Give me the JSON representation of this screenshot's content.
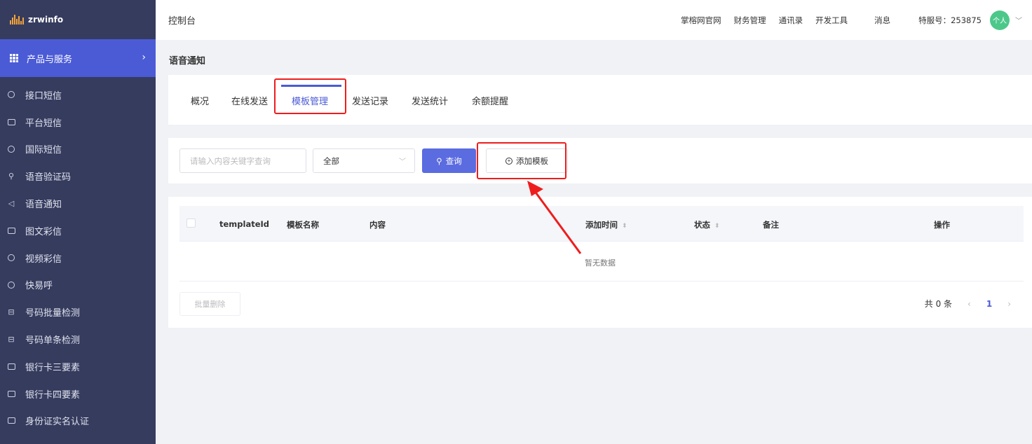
{
  "sidebar": {
    "logo_text": "zrwinfo",
    "header_label": "产品与服务",
    "items": [
      {
        "label": "接口短信",
        "icon": "message-bubble-icon"
      },
      {
        "label": "平台短信",
        "icon": "chat-icon"
      },
      {
        "label": "国际短信",
        "icon": "globe-icon"
      },
      {
        "label": "语音验证码",
        "icon": "microphone-icon"
      },
      {
        "label": "语音通知",
        "icon": "speaker-icon"
      },
      {
        "label": "图文彩信",
        "icon": "image-icon"
      },
      {
        "label": "视频彩信",
        "icon": "play-icon"
      },
      {
        "label": "快易呼",
        "icon": "call-icon"
      },
      {
        "label": "号码批量检测",
        "icon": "scan-icon"
      },
      {
        "label": "号码单条检测",
        "icon": "scan-icon"
      },
      {
        "label": "银行卡三要素",
        "icon": "card-icon"
      },
      {
        "label": "银行卡四要素",
        "icon": "card-icon"
      },
      {
        "label": "身份证实名认证",
        "icon": "id-card-icon"
      }
    ]
  },
  "topbar": {
    "title": "控制台",
    "links": [
      "掌榕网官网",
      "财务管理",
      "通讯录",
      "开发工具"
    ],
    "messages": "消息",
    "account": "特服号：253875",
    "avatar_text": "个人"
  },
  "page": {
    "title": "语音通知"
  },
  "tabs": [
    {
      "label": "概况",
      "active": false
    },
    {
      "label": "在线发送",
      "active": false
    },
    {
      "label": "模板管理",
      "active": true
    },
    {
      "label": "发送记录",
      "active": false
    },
    {
      "label": "发送统计",
      "active": false
    },
    {
      "label": "余额提醒",
      "active": false
    }
  ],
  "search": {
    "placeholder": "请输入内容关键字查询",
    "select_value": "全部",
    "query_label": "查询",
    "add_label": "添加模板"
  },
  "table": {
    "columns": [
      "templateId",
      "模板名称",
      "内容",
      "添加时间",
      "状态",
      "备注",
      "操作"
    ],
    "empty_text": "暂无数据",
    "batch_delete": "批量删除"
  },
  "pagination": {
    "total": "共 0 条",
    "current": "1"
  },
  "colors": {
    "sidebar_bg": "#363c5e",
    "accent": "#4b5bd6",
    "annotation": "#ee1d1d"
  }
}
